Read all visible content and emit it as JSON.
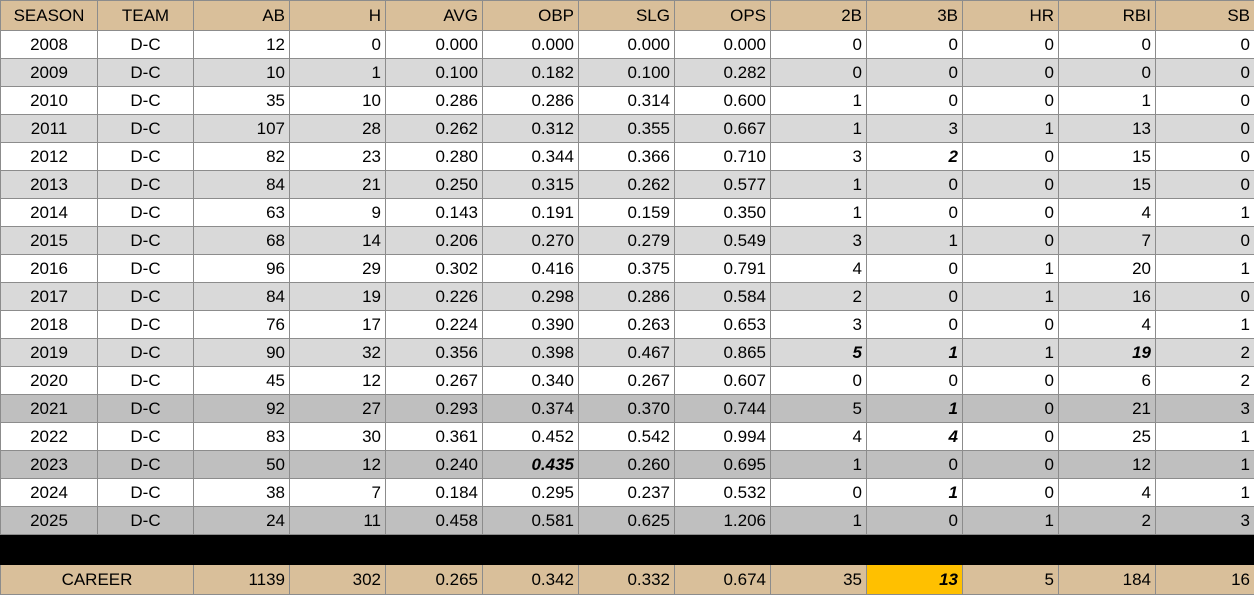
{
  "headers": [
    "SEASON",
    "TEAM",
    "AB",
    "H",
    "AVG",
    "OBP",
    "SLG",
    "OPS",
    "2B",
    "3B",
    "HR",
    "RBI",
    "SB"
  ],
  "rows": [
    {
      "shade": "plain",
      "cells": [
        "2008",
        "D-C",
        "12",
        "0",
        "0.000",
        "0.000",
        "0.000",
        "0.000",
        "0",
        "0",
        "0",
        "0",
        "0"
      ],
      "emph": []
    },
    {
      "shade": "light",
      "cells": [
        "2009",
        "D-C",
        "10",
        "1",
        "0.100",
        "0.182",
        "0.100",
        "0.282",
        "0",
        "0",
        "0",
        "0",
        "0"
      ],
      "emph": []
    },
    {
      "shade": "plain",
      "cells": [
        "2010",
        "D-C",
        "35",
        "10",
        "0.286",
        "0.286",
        "0.314",
        "0.600",
        "1",
        "0",
        "0",
        "1",
        "0"
      ],
      "emph": []
    },
    {
      "shade": "light",
      "cells": [
        "2011",
        "D-C",
        "107",
        "28",
        "0.262",
        "0.312",
        "0.355",
        "0.667",
        "1",
        "3",
        "1",
        "13",
        "0"
      ],
      "emph": []
    },
    {
      "shade": "plain",
      "cells": [
        "2012",
        "D-C",
        "82",
        "23",
        "0.280",
        "0.344",
        "0.366",
        "0.710",
        "3",
        "2",
        "0",
        "15",
        "0"
      ],
      "emph": [
        9
      ]
    },
    {
      "shade": "light",
      "cells": [
        "2013",
        "D-C",
        "84",
        "21",
        "0.250",
        "0.315",
        "0.262",
        "0.577",
        "1",
        "0",
        "0",
        "15",
        "0"
      ],
      "emph": []
    },
    {
      "shade": "plain",
      "cells": [
        "2014",
        "D-C",
        "63",
        "9",
        "0.143",
        "0.191",
        "0.159",
        "0.350",
        "1",
        "0",
        "0",
        "4",
        "1"
      ],
      "emph": []
    },
    {
      "shade": "light",
      "cells": [
        "2015",
        "D-C",
        "68",
        "14",
        "0.206",
        "0.270",
        "0.279",
        "0.549",
        "3",
        "1",
        "0",
        "7",
        "0"
      ],
      "emph": []
    },
    {
      "shade": "plain",
      "cells": [
        "2016",
        "D-C",
        "96",
        "29",
        "0.302",
        "0.416",
        "0.375",
        "0.791",
        "4",
        "0",
        "1",
        "20",
        "1"
      ],
      "emph": []
    },
    {
      "shade": "light",
      "cells": [
        "2017",
        "D-C",
        "84",
        "19",
        "0.226",
        "0.298",
        "0.286",
        "0.584",
        "2",
        "0",
        "1",
        "16",
        "0"
      ],
      "emph": []
    },
    {
      "shade": "plain",
      "cells": [
        "2018",
        "D-C",
        "76",
        "17",
        "0.224",
        "0.390",
        "0.263",
        "0.653",
        "3",
        "0",
        "0",
        "4",
        "1"
      ],
      "emph": []
    },
    {
      "shade": "light",
      "cells": [
        "2019",
        "D-C",
        "90",
        "32",
        "0.356",
        "0.398",
        "0.467",
        "0.865",
        "5",
        "1",
        "1",
        "19",
        "2"
      ],
      "emph": [
        8,
        9,
        11
      ]
    },
    {
      "shade": "plain",
      "cells": [
        "2020",
        "D-C",
        "45",
        "12",
        "0.267",
        "0.340",
        "0.267",
        "0.607",
        "0",
        "0",
        "0",
        "6",
        "2"
      ],
      "emph": []
    },
    {
      "shade": "dark",
      "cells": [
        "2021",
        "D-C",
        "92",
        "27",
        "0.293",
        "0.374",
        "0.370",
        "0.744",
        "5",
        "1",
        "0",
        "21",
        "3"
      ],
      "emph": [
        9
      ]
    },
    {
      "shade": "plain",
      "cells": [
        "2022",
        "D-C",
        "83",
        "30",
        "0.361",
        "0.452",
        "0.542",
        "0.994",
        "4",
        "4",
        "0",
        "25",
        "1"
      ],
      "emph": [
        9
      ]
    },
    {
      "shade": "dark",
      "cells": [
        "2023",
        "D-C",
        "50",
        "12",
        "0.240",
        "0.435",
        "0.260",
        "0.695",
        "1",
        "0",
        "0",
        "12",
        "1"
      ],
      "emph": [
        5
      ]
    },
    {
      "shade": "plain",
      "cells": [
        "2024",
        "D-C",
        "38",
        "7",
        "0.184",
        "0.295",
        "0.237",
        "0.532",
        "0",
        "1",
        "0",
        "4",
        "1"
      ],
      "emph": [
        9
      ]
    },
    {
      "shade": "dark",
      "cells": [
        "2025",
        "D-C",
        "24",
        "11",
        "0.458",
        "0.581",
        "0.625",
        "1.206",
        "1",
        "0",
        "1",
        "2",
        "3"
      ],
      "emph": []
    }
  ],
  "career": {
    "label": "CAREER",
    "cells": [
      "1139",
      "302",
      "0.265",
      "0.342",
      "0.332",
      "0.674",
      "35",
      "13",
      "5",
      "184",
      "16"
    ],
    "highlight_index": 7
  },
  "colors": {
    "header_bg": "#d9bf9a",
    "row_light": "#d9d9d9",
    "row_dark": "#bfbfbf",
    "highlight": "#ffc000"
  }
}
